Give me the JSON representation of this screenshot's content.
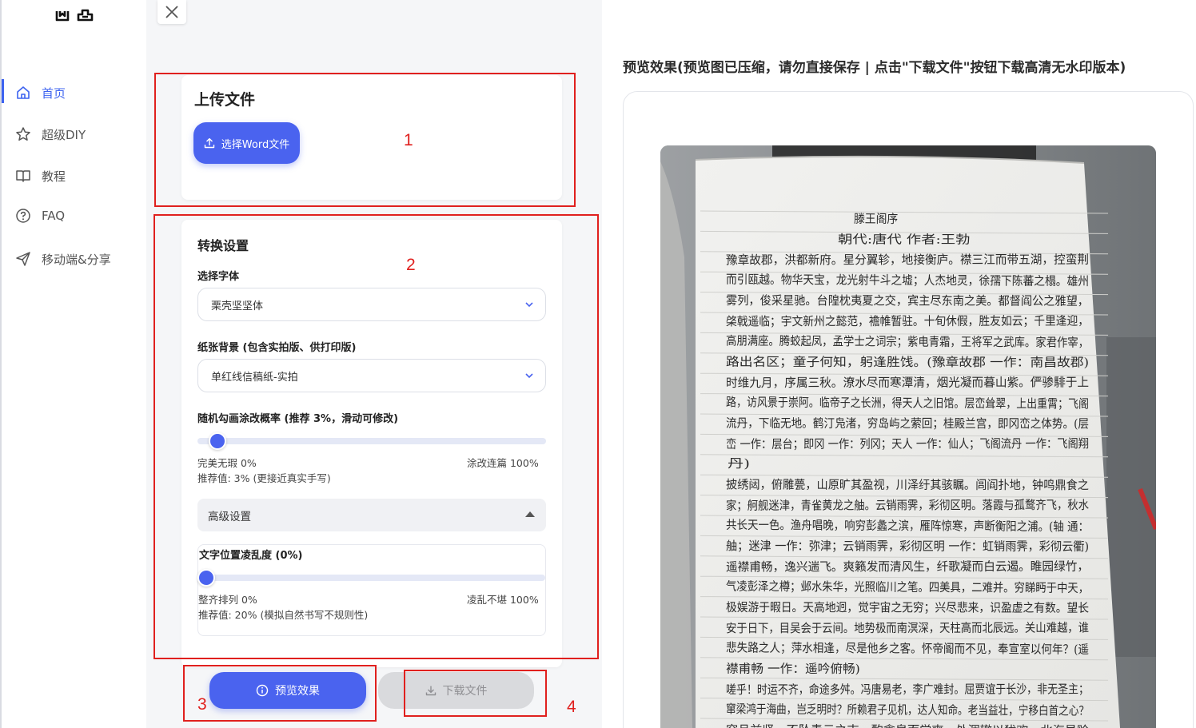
{
  "sidebar": {
    "logo": "ᗜᗝ",
    "items": [
      {
        "label": "首页",
        "icon": "home-icon",
        "active": true
      },
      {
        "label": "超级DIY",
        "icon": "star-icon",
        "active": false
      },
      {
        "label": "教程",
        "icon": "book-icon",
        "active": false
      },
      {
        "label": "FAQ",
        "icon": "question-icon",
        "active": false
      },
      {
        "label": "移动端&分享",
        "icon": "send-icon",
        "active": false
      }
    ]
  },
  "upload": {
    "title": "上传文件",
    "button_label": "选择Word文件"
  },
  "settings": {
    "title": "转换设置",
    "font_label": "选择字体",
    "font_value": "栗壳坚坚体",
    "paper_label": "纸张背景 (包含实拍版、供打印版)",
    "paper_value": "单红线信稿纸-实拍",
    "scribble_label": "随机勾画涂改概率 (推荐 3%，滑动可修改)",
    "scribble_value": 0.03,
    "scribble_min": "完美无瑕 0%",
    "scribble_max": "涂改连篇 100%",
    "scribble_hint": "推荐值: 3% (更接近真实手写)",
    "advanced_label": "高级设置",
    "chaos_label": "文字位置凌乱度 (0%)",
    "chaos_value": 0,
    "chaos_min": "整齐排列 0%",
    "chaos_max": "凌乱不堪 100%",
    "chaos_hint": "推荐值: 20% (模拟自然书写不规则性)"
  },
  "actions": {
    "preview_label": "预览效果",
    "download_label": "下载文件"
  },
  "annotations": [
    "1",
    "2",
    "3",
    "4"
  ],
  "preview": {
    "title": "预览效果(预览图已压缩，请勿直接保存 | 点击\"下载文件\"按钮下载高清无水印版本)",
    "lines": [
      "滕王阁序",
      "朝代:唐代  作者:王勃",
      "豫章故郡，洪都新府。星分翼轸，地接衡庐。襟三江而带五湖，控蛮荆",
      "而引瓯越。物华天宝，龙光射牛斗之墟；人杰地灵，徐孺下陈蕃之榻。雄州",
      "雾列，俊采星驰。台隍枕夷夏之交，宾主尽东南之美。都督阎公之雅望，",
      "棨戟遥临；宇文新州之懿范，襜帷暂驻。十旬休假，胜友如云；千里逢迎，",
      "高朋满座。腾蛟起凤，孟学士之词宗；紫电青霜，王将军之武库。家君作宰，",
      "路出名区；童子何知，躬逢胜饯。(豫章故郡 一作：南昌故郡)",
      "时维九月，序属三秋。潦水尽而寒潭清，烟光凝而暮山紫。俨骖騑于上",
      "路，访风景于崇阿。临帝子之长洲，得天人之旧馆。层峦耸翠，上出重霄；飞阁",
      "流丹，下临无地。鹤汀凫渚，穷岛屿之萦回；桂殿兰宫，即冈峦之体势。(层",
      "峦 一作：层台；即冈 一作：列冈；天人 一作：仙人；飞阁流丹 一作：飞阁翔",
      "丹)",
      "披绣闼，俯雕甍，山原旷其盈视，川泽纡其骇瞩。闾阎扑地，钟鸣鼎食之",
      "家；舸舰迷津，青雀黄龙之舳。云销雨霁，彩彻区明。落霞与孤鹜齐飞，秋水",
      "共长天一色。渔舟唱晚，响穷彭蠡之滨，雁阵惊寒，声断衡阳之浦。(轴 通：",
      "舳；迷津 一作：弥津；云销雨霁，彩彻区明 一作：虹销雨霁，彩彻云衢)",
      "遥襟甫畅，逸兴遄飞。爽籁发而清风生，纤歌凝而白云遏。睢园绿竹，",
      "气凌彭泽之樽；邺水朱华，光照临川之笔。四美具，二难并。穷睇眄于中天，",
      "极娱游于暇日。天高地迥，觉宇宙之无穷；兴尽悲来，识盈虚之有数。望长",
      "安于日下，目吴会于云间。地势极而南溟深，天柱高而北辰远。关山难越，谁",
      "悲失路之人；萍水相逢，尽是他乡之客。怀帝阍而不见，奉宣室以何年？(遥",
      "襟甫畅 一作：遥吟俯畅)",
      "嗟乎！时运不齐，命途多舛。冯唐易老，李广难封。屈贾谊于长沙，非无圣主；",
      "窜梁鸿于海曲，岂乏明时？所赖君子见机，达人知命。老当益壮，宁移白首之心？",
      "穷且益坚，不坠青云之志。酌贪泉而觉爽，处涸辙以犹欢。北海虽赊"
    ]
  },
  "colors": {
    "accent": "#4a63ef",
    "annotation_red": "#e0201e",
    "ink": "#2a2a2a",
    "paper": "#f4f4f2",
    "margin_line": "#d95a5a"
  }
}
